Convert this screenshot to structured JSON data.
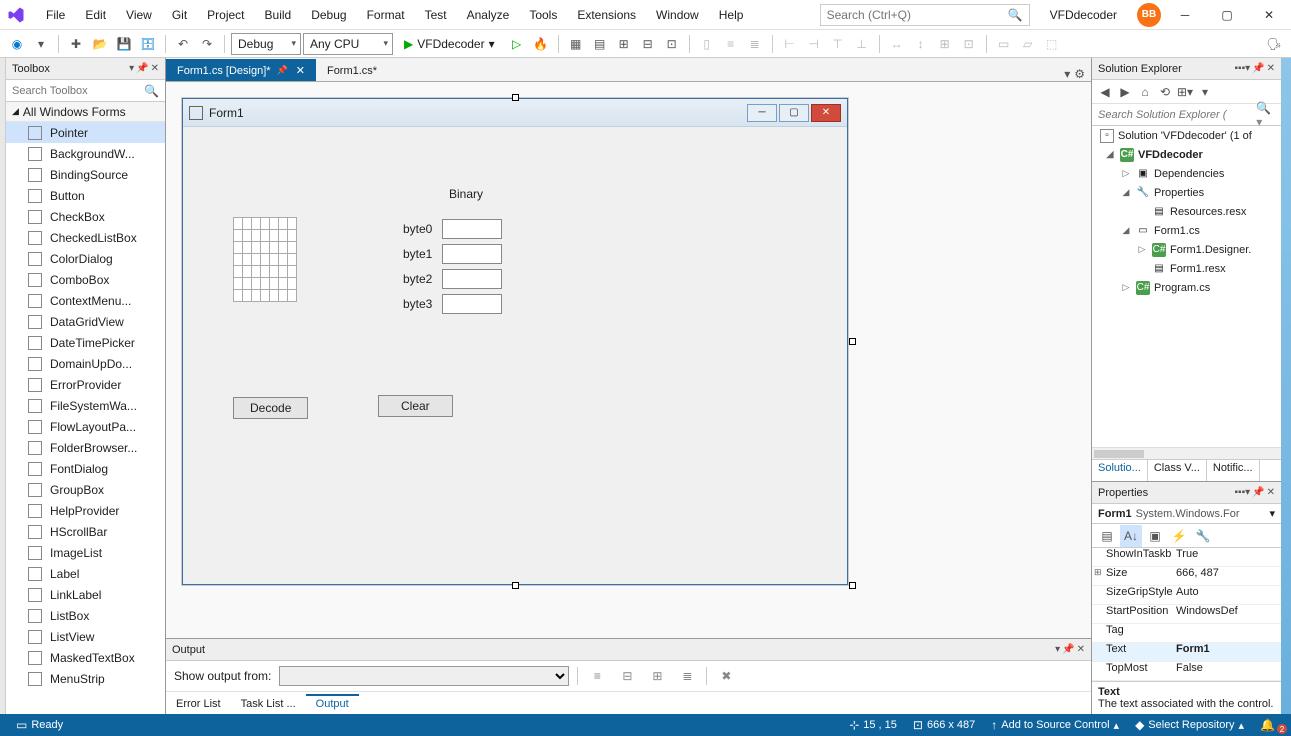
{
  "app": {
    "project_name": "VFDdecoder",
    "user_initials": "BB"
  },
  "menu": [
    "File",
    "Edit",
    "View",
    "Git",
    "Project",
    "Build",
    "Debug",
    "Format",
    "Test",
    "Analyze",
    "Tools",
    "Extensions",
    "Window",
    "Help"
  ],
  "search": {
    "placeholder": "Search (Ctrl+Q)"
  },
  "toolbar": {
    "config": "Debug",
    "platform": "Any CPU",
    "start_target": "VFDdecoder"
  },
  "toolbox": {
    "title": "Toolbox",
    "search_placeholder": "Search Toolbox",
    "category": "All Windows Forms",
    "items": [
      "Pointer",
      "BackgroundW...",
      "BindingSource",
      "Button",
      "CheckBox",
      "CheckedListBox",
      "ColorDialog",
      "ComboBox",
      "ContextMenu...",
      "DataGridView",
      "DateTimePicker",
      "DomainUpDo...",
      "ErrorProvider",
      "FileSystemWa...",
      "FlowLayoutPa...",
      "FolderBrowser...",
      "FontDialog",
      "GroupBox",
      "HelpProvider",
      "HScrollBar",
      "ImageList",
      "Label",
      "LinkLabel",
      "ListBox",
      "ListView",
      "MaskedTextBox",
      "MenuStrip"
    ],
    "selected_index": 0
  },
  "tabs": {
    "active": "Form1.cs [Design]*",
    "inactive": "Form1.cs*"
  },
  "form": {
    "title": "Form1",
    "binary_label": "Binary",
    "bytes": [
      "byte0",
      "byte1",
      "byte2",
      "byte3"
    ],
    "decode_btn": "Decode",
    "clear_btn": "Clear"
  },
  "output": {
    "title": "Output",
    "show_from_label": "Show output from:",
    "tabs": [
      "Error List",
      "Task List ...",
      "Output"
    ],
    "active_tab": 2
  },
  "solution_explorer": {
    "title": "Solution Explorer",
    "search_placeholder": "Search Solution Explorer (",
    "solution_label": "Solution 'VFDdecoder' (1 of",
    "project": "VFDdecoder",
    "nodes": {
      "dependencies": "Dependencies",
      "properties": "Properties",
      "resources": "Resources.resx",
      "form1": "Form1.cs",
      "form1_designer": "Form1.Designer.",
      "form1_resx": "Form1.resx",
      "program": "Program.cs"
    },
    "bottom_tabs": [
      "Solutio...",
      "Class V...",
      "Notific..."
    ]
  },
  "properties": {
    "title": "Properties",
    "object": "Form1 System.Windows.For",
    "rows": [
      {
        "name": "ShowInTaskb",
        "value": "True"
      },
      {
        "name": "Size",
        "value": "666, 487",
        "expand": true
      },
      {
        "name": "SizeGripStyle",
        "value": "Auto"
      },
      {
        "name": "StartPosition",
        "value": "WindowsDef"
      },
      {
        "name": "Tag",
        "value": ""
      },
      {
        "name": "Text",
        "value": "Form1",
        "selected": true
      },
      {
        "name": "TopMost",
        "value": "False"
      }
    ],
    "desc_name": "Text",
    "desc_text": "The text associated with the control."
  },
  "statusbar": {
    "ready": "Ready",
    "pos": "15 , 15",
    "size": "666 x 487",
    "source_control": "Add to Source Control",
    "repo": "Select Repository"
  }
}
